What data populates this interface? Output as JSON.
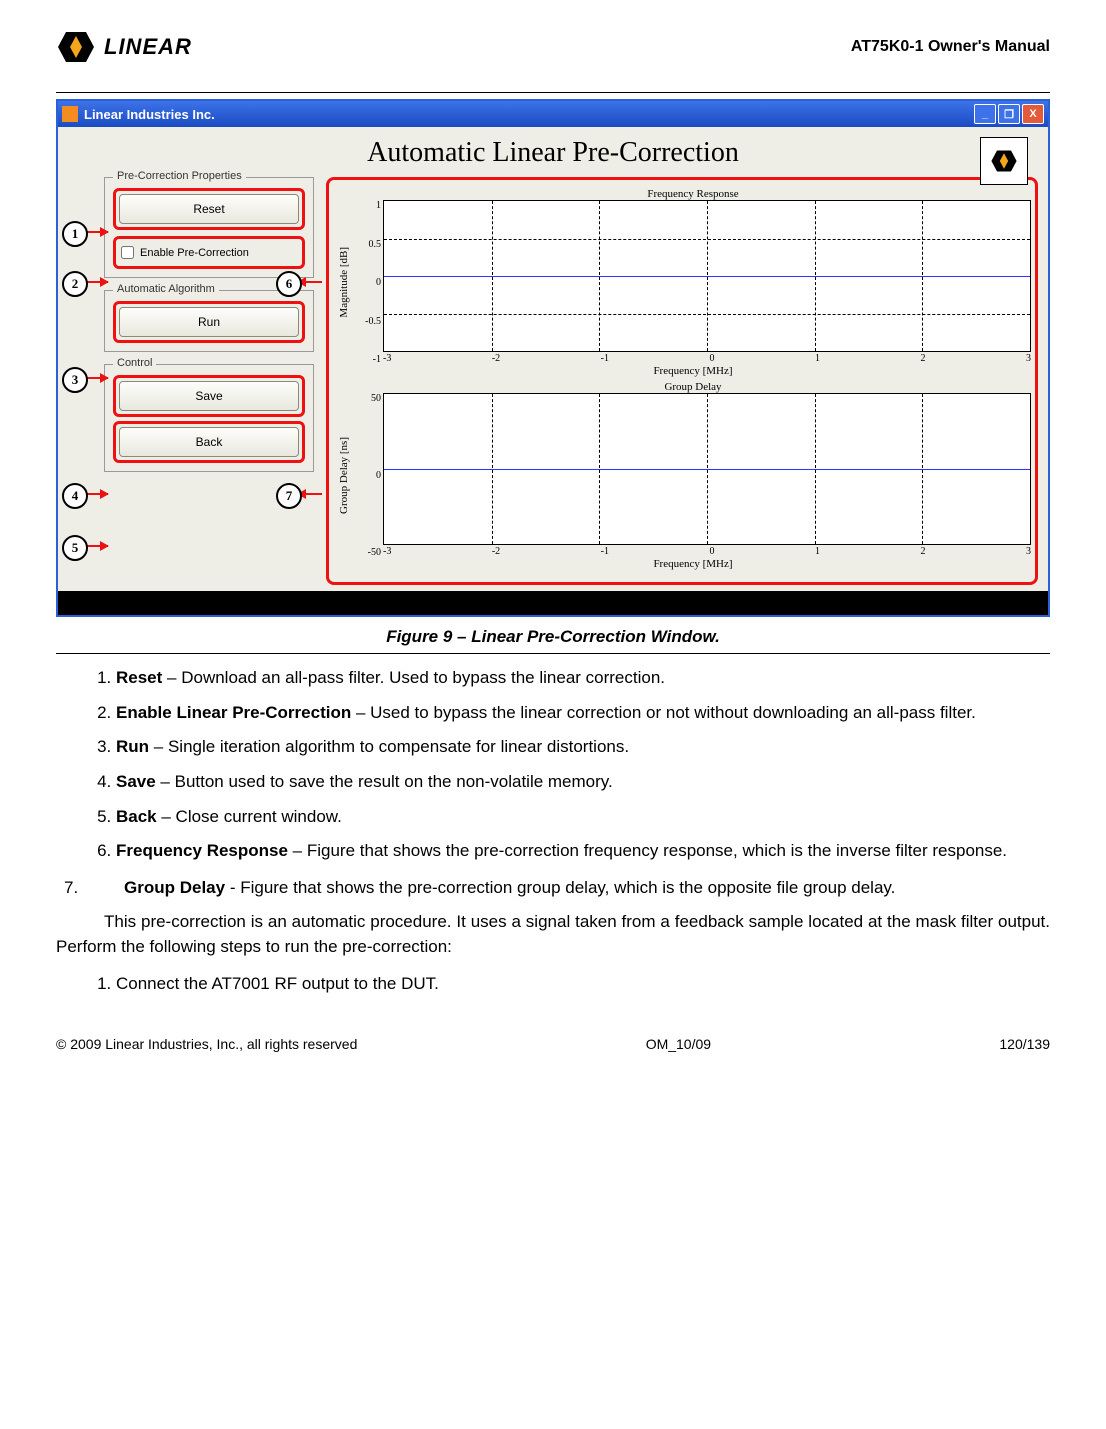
{
  "header": {
    "doc_title": "AT75K0-1 Owner's Manual",
    "brand": "LINEAR"
  },
  "figure_caption": "Figure 9 – Linear Pre-Correction Window.",
  "app": {
    "window_title": "Linear Industries Inc.",
    "title": "Automatic Linear Pre-Correction",
    "logo_small": "LINEAR",
    "groups": {
      "precorr": {
        "legend": "Pre-Correction Properties",
        "reset": "Reset",
        "enable": "Enable Pre-Correction"
      },
      "algo": {
        "legend": "Automatic Algorithm",
        "run": "Run"
      },
      "control": {
        "legend": "Control",
        "save": "Save",
        "back": "Back"
      }
    },
    "callouts": {
      "c1": "1",
      "c2": "2",
      "c3": "3",
      "c4": "4",
      "c5": "5",
      "c6": "6",
      "c7": "7"
    }
  },
  "chart_data": [
    {
      "type": "line",
      "title": "Frequency Response",
      "xlabel": "Frequency [MHz]",
      "ylabel": "Magnitude [dB]",
      "x": [
        -3,
        -2,
        -1,
        0,
        1,
        2,
        3
      ],
      "y": [
        0,
        0,
        0,
        0,
        0,
        0,
        0
      ],
      "xlim": [
        -3,
        3
      ],
      "ylim": [
        -1,
        1
      ],
      "xticks": [
        "-3",
        "-2",
        "-1",
        "0",
        "1",
        "2",
        "3"
      ],
      "yticks": [
        "1",
        "0.5",
        "0",
        "-0.5",
        "-1"
      ]
    },
    {
      "type": "line",
      "title": "Group Delay",
      "xlabel": "Frequency [MHz]",
      "ylabel": "Group Delay [ns]",
      "x": [
        -3,
        -2,
        -1,
        0,
        1,
        2,
        3
      ],
      "y": [
        0,
        0,
        0,
        0,
        0,
        0,
        0
      ],
      "xlim": [
        -3,
        3
      ],
      "ylim": [
        -50,
        50
      ],
      "xticks": [
        "-3",
        "-2",
        "-1",
        "0",
        "1",
        "2",
        "3"
      ],
      "yticks": [
        "50",
        "0",
        "-50"
      ]
    }
  ],
  "list": {
    "i1": {
      "b": "Reset",
      "t": " – Download an all-pass filter. Used to bypass the linear correction."
    },
    "i2": {
      "b": "Enable Linear Pre-Correction",
      "t": " – Used to bypass the linear correction or not without downloading an all-pass filter."
    },
    "i3": {
      "b": "Run",
      "t": " – Single iteration algorithm to compensate for linear distortions."
    },
    "i4": {
      "b": "Save",
      "t": " – Button used to save the result on the non-volatile memory."
    },
    "i5": {
      "b": "Back",
      "t": " – Close current window."
    },
    "i6": {
      "b": "Frequency Response",
      "t": " – Figure that shows the pre-correction frequency response, which is the inverse filter response."
    },
    "i7": {
      "num": "7.",
      "b": "Group Delay",
      "t": " - Figure that shows the pre-correction group delay, which is the opposite file group delay."
    }
  },
  "para1": "This pre-correction is an automatic procedure. It uses a signal taken from a feedback sample located at the mask filter output. Perform the following steps to run the pre-correction:",
  "steps": {
    "s1": "Connect the AT7001 RF output to the DUT."
  },
  "footer": {
    "copyright": "© 2009 Linear Industries, Inc., all rights reserved",
    "code": "OM_10/09",
    "page": "120/139"
  }
}
